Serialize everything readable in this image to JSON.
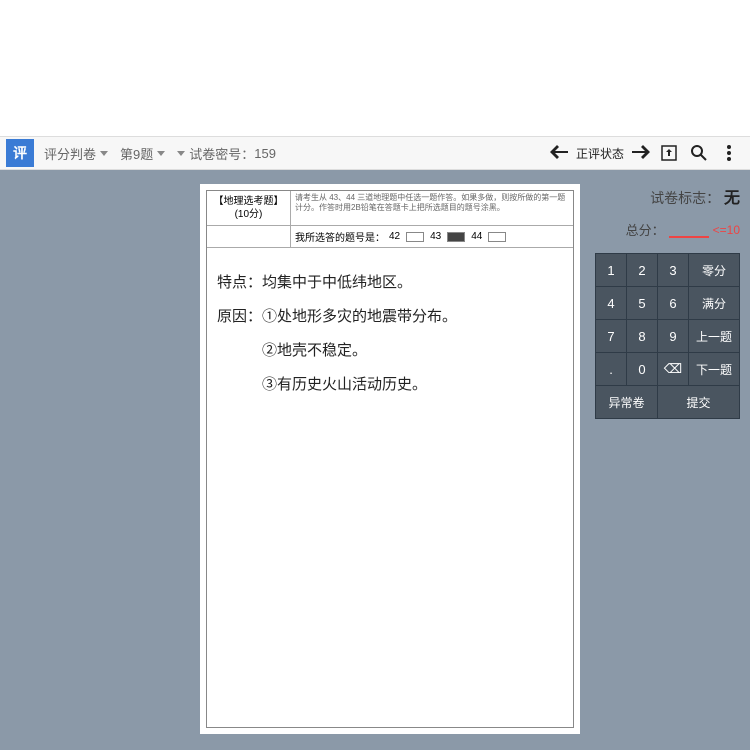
{
  "toolbar": {
    "app_name": "评分判卷",
    "question": "第9题",
    "paper_id_label": "试卷密号：",
    "paper_id": "159",
    "status": "正评状态"
  },
  "paper": {
    "subject_label": "【地理选考题】",
    "points_label": "(10分)",
    "instruction_blurb": "请考生从 43、44 三道地理题中任选一题作答。如果多做，则按所做的第一题计分。作答时用2B铅笔在答题卡上把所选题目的题号涂黑。",
    "choice_label": "我所选答的题号是：",
    "q_nums": [
      "42",
      "43",
      "44"
    ],
    "filled_index": 1,
    "answers": [
      "特点：均集中于中低纬地区。",
      "原因：①处地形多灾的地震带分布。",
      "　　　②地壳不稳定。",
      "　　　③有历史火山活动历史。"
    ]
  },
  "side": {
    "mark_label": "试卷标志：",
    "mark_value": "无",
    "score_label": "总分：",
    "score_value": "",
    "score_max": "<=10"
  },
  "keypad": {
    "keys": [
      [
        "1",
        "2",
        "3",
        "零分"
      ],
      [
        "4",
        "5",
        "6",
        "满分"
      ],
      [
        "7",
        "8",
        "9",
        "上一题"
      ],
      [
        ".",
        "0",
        "⌫",
        "下一题"
      ]
    ],
    "bottom": [
      "异常卷",
      "提交"
    ]
  }
}
